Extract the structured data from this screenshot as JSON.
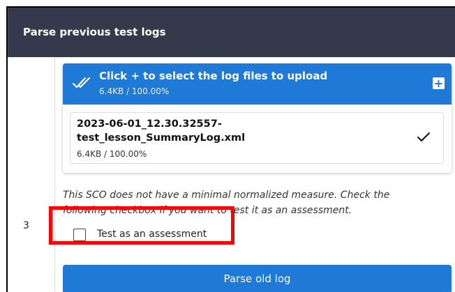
{
  "header": {
    "title": "Parse previous test logs"
  },
  "row": {
    "number": "3"
  },
  "upload": {
    "title": "Click + to select the log files to upload",
    "subtitle": "6.4KB / 100.00%",
    "add_label": "+",
    "add_icon": "plus-icon",
    "header_icon": "double-check-icon",
    "accent_color": "#1e7ad6",
    "files": [
      {
        "name_line1": "2023-06-01_12.30.32557-",
        "name_line2": "test_lesson_SummaryLog.xml",
        "size": "6.4KB / 100.00%",
        "status_icon": "check-icon"
      }
    ]
  },
  "note": {
    "line1": "This SCO does not have a minimal normalized measure. Check the",
    "line2": "following checkbox if you want to test it as an assessment."
  },
  "assessment": {
    "label": "Test as an assessment",
    "checked": false
  },
  "actions": {
    "parse_label": "Parse old log"
  },
  "annotation": {
    "highlight_color": "#ff0000"
  }
}
